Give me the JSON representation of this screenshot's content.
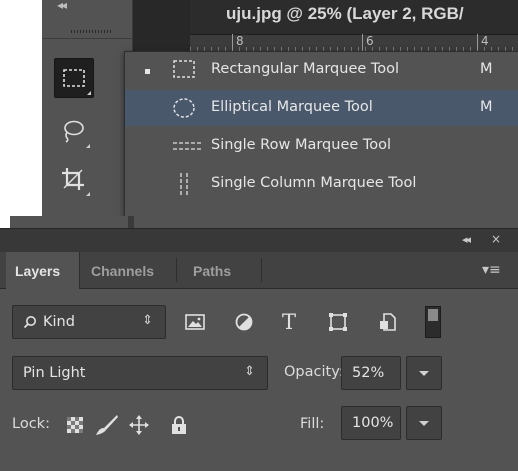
{
  "document": {
    "title": "uju.jpg @ 25% (Layer 2, RGB/",
    "ruler_numbers": [
      "8",
      "6",
      "4"
    ]
  },
  "toolbar": {
    "collapse_icon": "double-chevron-left-icon",
    "tools": [
      {
        "name": "rectangular-marquee",
        "icon": "rect-marquee-icon",
        "selected": true
      },
      {
        "name": "lasso",
        "icon": "lasso-icon"
      },
      {
        "name": "crop",
        "icon": "crop-icon"
      }
    ]
  },
  "flyout": {
    "items": [
      {
        "label": "Rectangular Marquee Tool",
        "shortcut": "M",
        "icon": "rect-marquee-icon",
        "checked": true
      },
      {
        "label": "Elliptical Marquee Tool",
        "shortcut": "M",
        "icon": "ellipse-marquee-icon",
        "highlighted": true
      },
      {
        "label": "Single Row Marquee Tool",
        "shortcut": "",
        "icon": "row-marquee-icon"
      },
      {
        "label": "Single Column Marquee Tool",
        "shortcut": "",
        "icon": "column-marquee-icon"
      }
    ]
  },
  "layers_panel": {
    "collapse_glyph": "◂◂",
    "close_glyph": "×",
    "menu_glyph": "▾≡",
    "tabs": [
      {
        "label": "Layers",
        "active": true
      },
      {
        "label": "Channels"
      },
      {
        "label": "Paths"
      }
    ],
    "filter": {
      "kind_label": "Kind",
      "arrows_glyph": "⇕",
      "type_glyph": "T",
      "icons": [
        "image-filter-icon",
        "adjustment-filter-icon",
        "type-filter-icon",
        "shape-filter-icon",
        "smart-object-filter-icon"
      ]
    },
    "blend_mode": "Pin Light",
    "opacity_label": "Opacity:",
    "opacity_value": "52%",
    "lock_label": "Lock:",
    "lock_icons": [
      "lock-transparent-icon",
      "lock-brush-icon",
      "lock-position-icon",
      "lock-all-icon"
    ],
    "fill_label": "Fill:",
    "fill_value": "100%"
  },
  "colors": {
    "panel_bg": "#535353",
    "panel_header": "#383838",
    "menu_highlight": "#4a586b",
    "text": "#e4e4e4"
  }
}
